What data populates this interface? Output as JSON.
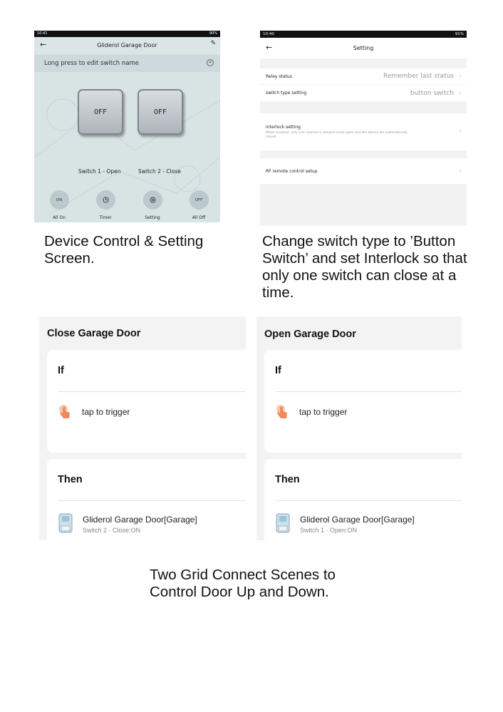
{
  "device_screen": {
    "status_time": "10:41",
    "status_right": "90%",
    "title": "Gliderol Garage Door",
    "hint": "Long press to edit switch name",
    "switch1": {
      "state": "OFF",
      "label": "Switch 1 - Open"
    },
    "switch2": {
      "state": "OFF",
      "label": "Switch 2 - Close"
    },
    "bottom_actions": [
      {
        "icon": "ON",
        "label": "All On"
      },
      {
        "icon": "timer-icon",
        "label": "Timer"
      },
      {
        "icon": "settings-icon",
        "label": "Setting"
      },
      {
        "icon": "OFF",
        "label": "All Off"
      }
    ]
  },
  "setting_screen": {
    "status_time": "10:40",
    "status_right": "91%",
    "title": "Setting",
    "rows": [
      {
        "label": "Relay status",
        "value": "Remember last status"
      },
      {
        "label": "switch type setting",
        "value": "button switch"
      },
      {
        "label": "interlock setting",
        "sub": "When enabled, only one channel is allowed to be open and the others are automatically closed"
      },
      {
        "label": "RF remote control setup"
      }
    ]
  },
  "captions": {
    "device": "Device Control & Setting Screen.",
    "setting": "Change switch type to ’Button Switch’ and set Interlock so that only one switch can close at a time.",
    "scenes": "Two Grid Connect Scenes to Control Door Up and Down."
  },
  "scenes": [
    {
      "title": "Close Garage Door",
      "if_label": "If",
      "trigger": "tap to trigger",
      "then_label": "Then",
      "device_name": "Gliderol Garage Door[Garage]",
      "device_action": "Switch 2 · Close:ON"
    },
    {
      "title": "Open Garage Door",
      "if_label": "If",
      "trigger": "tap to trigger",
      "then_label": "Then",
      "device_name": "Gliderol Garage Door[Garage]",
      "device_action": "Switch 1 · Open:ON"
    }
  ],
  "colors": {
    "device_bg": "#d8e3e4",
    "trigger_icon": "#f08a5d"
  }
}
